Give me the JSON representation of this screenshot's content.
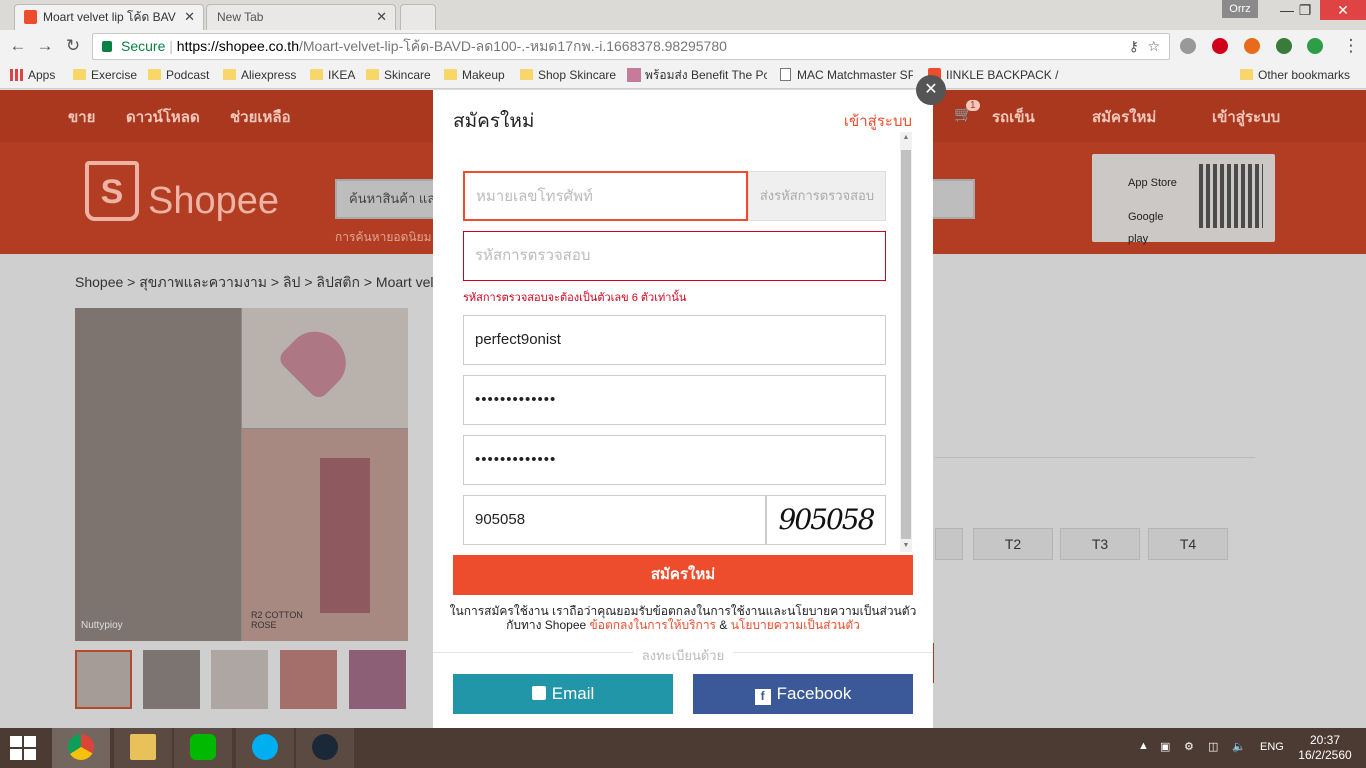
{
  "browser": {
    "tabs": [
      {
        "title": "Moart velvet lip โค้ด BAV",
        "active": true
      },
      {
        "title": "New Tab",
        "active": false
      }
    ],
    "profile": "Orrz",
    "secure_label": "Secure",
    "url_host": "https://shopee.co.th",
    "url_path": "/Moart-velvet-lip-โค้ด-BAVD-ลด100-.-หมด17กพ.-i.1668378.98295780",
    "bookmarks": [
      {
        "label": "Apps",
        "icon": "apps-grid-icon"
      },
      {
        "label": "Exercise",
        "icon": "folder-icon"
      },
      {
        "label": "Podcast",
        "icon": "folder-icon"
      },
      {
        "label": "Aliexpress",
        "icon": "folder-icon"
      },
      {
        "label": "IKEA",
        "icon": "folder-icon"
      },
      {
        "label": "Skincare",
        "icon": "folder-icon"
      },
      {
        "label": "Makeup",
        "icon": "folder-icon"
      },
      {
        "label": "Shop Skincare",
        "icon": "folder-icon"
      },
      {
        "label": "พร้อมส่ง Benefit The Pc",
        "icon": "image-icon"
      },
      {
        "label": "MAC Matchmaster SP",
        "icon": "page-icon"
      },
      {
        "label": "IINKLE BACKPACK / ล",
        "icon": "shopee-icon"
      },
      {
        "label": "Other bookmarks",
        "icon": "folder-icon"
      }
    ]
  },
  "shopee": {
    "nav_left": [
      "ขาย",
      "ดาวน์โหลด",
      "ช่วยเหลือ"
    ],
    "nav_right": {
      "cart_count": "1",
      "coins": "รถเข็น",
      "signup": "สมัครใหม่",
      "login": "เข้าสู่ระบบ"
    },
    "logo_text": "Shopee",
    "search_placeholder": "ค้นหาสินค้า แล",
    "search_hint": "การค้นหายอดนิยม",
    "app_store": "App Store",
    "google_play": "Google play",
    "breadcrumb": "Shopee  >  สุขภาพและความงาม  >  ลิป  >  ลิปสติก  >  Moart velv",
    "image_watermark": "Nuttypioy",
    "image_caption": "R2 COTTON ROSE",
    "variant_buttons": [
      "T2",
      "T3",
      "T4"
    ]
  },
  "modal": {
    "title": "สมัครใหม่",
    "login_link": "เข้าสู่ระบบ",
    "phone_placeholder": "หมายเลขโทรศัพท์",
    "send_code": "ส่งรหัสการตรวจสอบ",
    "code_placeholder": "รหัสการตรวจสอบ",
    "code_error": "รหัสการตรวจสอบจะต้องเป็นตัวเลข 6 ตัวเท่านั้น",
    "username": "perfect9onist",
    "password": "•••••••••••••",
    "password_confirm": "•••••••••••••",
    "captcha_value": "905058",
    "captcha_image_text": "905058",
    "submit": "สมัครใหม่",
    "terms_prefix": "ในการสมัครใช้งาน เราถือว่าคุณยอมรับข้อตกลงในการใช้งานและนโยบายความเป็นส่วนตัวกับทาง Shopee",
    "terms_link": "ข้อตกลงในการให้บริการ",
    "terms_and": "&",
    "privacy_link": "นโยบายความเป็นส่วนตัว",
    "divider": "ลงทะเบียนด้วย",
    "email_btn": "Email",
    "facebook_btn": "Facebook"
  },
  "taskbar": {
    "apps": [
      "chrome-icon",
      "file-explorer-icon",
      "line-icon",
      "skype-icon",
      "steam-icon"
    ],
    "language": "ENG",
    "time": "20:37",
    "date": "16/2/2560"
  },
  "colors": {
    "brand": "#ee4d2d",
    "facebook": "#3b5998",
    "email": "#2196a9",
    "error": "#d0011b"
  }
}
